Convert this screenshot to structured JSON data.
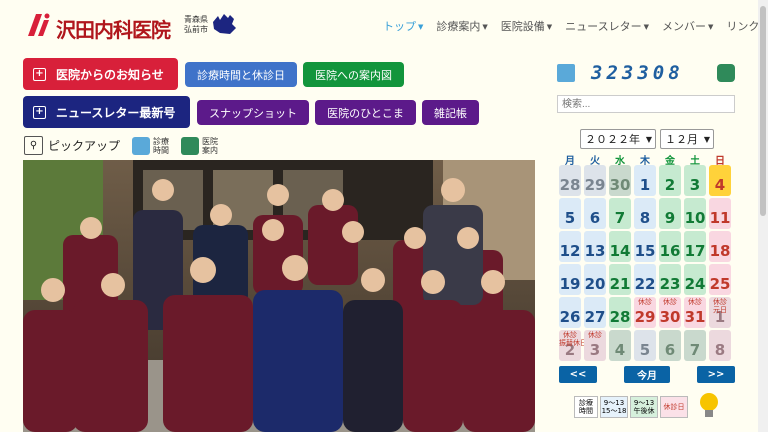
{
  "header": {
    "logo_text": "沢田内科医院",
    "logo_pref": "青森県",
    "logo_city": "弘前市"
  },
  "nav": [
    {
      "label": "トップ",
      "caret": true
    },
    {
      "label": "診療案内",
      "caret": true
    },
    {
      "label": "医院設備",
      "caret": true
    },
    {
      "label": "ニュースレター",
      "caret": true
    },
    {
      "label": "メンバー",
      "caret": true
    },
    {
      "label": "リンク",
      "caret": false
    }
  ],
  "buttons": {
    "news": "医院からのお知らせ",
    "newsletter": "ニュースレター最新号",
    "hours": "診療時間と休診日",
    "map": "医院への案内図",
    "snapshot": "スナップショット",
    "hitokoma": "医院のひとこま",
    "notes": "雑記帳"
  },
  "pickup": {
    "label": "ピックアップ",
    "hours_line1": "診療",
    "hours_line2": "時間",
    "guide_line1": "医院",
    "guide_line2": "案内"
  },
  "counter": "323308",
  "search": {
    "placeholder": "検索..."
  },
  "calendar": {
    "year": "２０２２年",
    "month": "１２月",
    "weekdays": [
      "月",
      "火",
      "水",
      "木",
      "金",
      "土",
      "日"
    ],
    "days": [
      {
        "d": "28",
        "t": "other"
      },
      {
        "d": "29",
        "t": "other"
      },
      {
        "d": "30",
        "t": "green-other"
      },
      {
        "d": "1",
        "t": "blue"
      },
      {
        "d": "2",
        "t": "green"
      },
      {
        "d": "3",
        "t": "green"
      },
      {
        "d": "4",
        "t": "today"
      },
      {
        "d": "5",
        "t": "blue"
      },
      {
        "d": "6",
        "t": "blue"
      },
      {
        "d": "7",
        "t": "green"
      },
      {
        "d": "8",
        "t": "blue"
      },
      {
        "d": "9",
        "t": "green"
      },
      {
        "d": "10",
        "t": "green"
      },
      {
        "d": "11",
        "t": "pink"
      },
      {
        "d": "12",
        "t": "blue"
      },
      {
        "d": "13",
        "t": "blue"
      },
      {
        "d": "14",
        "t": "green"
      },
      {
        "d": "15",
        "t": "blue"
      },
      {
        "d": "16",
        "t": "green"
      },
      {
        "d": "17",
        "t": "green"
      },
      {
        "d": "18",
        "t": "pink"
      },
      {
        "d": "19",
        "t": "blue"
      },
      {
        "d": "20",
        "t": "blue"
      },
      {
        "d": "21",
        "t": "green"
      },
      {
        "d": "22",
        "t": "blue"
      },
      {
        "d": "23",
        "t": "green"
      },
      {
        "d": "24",
        "t": "green"
      },
      {
        "d": "25",
        "t": "pink"
      },
      {
        "d": "26",
        "t": "blue"
      },
      {
        "d": "27",
        "t": "blue"
      },
      {
        "d": "28",
        "t": "green"
      },
      {
        "d": "29",
        "t": "pink",
        "tag": "休診"
      },
      {
        "d": "30",
        "t": "pink",
        "tag": "休診"
      },
      {
        "d": "31",
        "t": "pink",
        "tag": "休診"
      },
      {
        "d": "1",
        "t": "pink-other",
        "tag": "休診\n元日"
      },
      {
        "d": "2",
        "t": "pink-other",
        "tag": "休診\n振替休日"
      },
      {
        "d": "3",
        "t": "pink-other",
        "tag": "休診"
      },
      {
        "d": "4",
        "t": "green-other"
      },
      {
        "d": "5",
        "t": "other"
      },
      {
        "d": "6",
        "t": "green-other"
      },
      {
        "d": "7",
        "t": "green-other"
      },
      {
        "d": "8",
        "t": "pink-other"
      }
    ],
    "prev": "<<",
    "today": "今月",
    "next": ">>"
  },
  "legend": {
    "label": "診療\n時間",
    "morning": "9～13\n15～18",
    "half": "9～13\n午後休",
    "closed": "休診日"
  },
  "colors": {
    "accent_red": "#d8203a",
    "navy": "#1c2580",
    "blue_btn": "#3f73c9",
    "green_btn": "#12953c",
    "purple_btn": "#5c1a8a"
  }
}
